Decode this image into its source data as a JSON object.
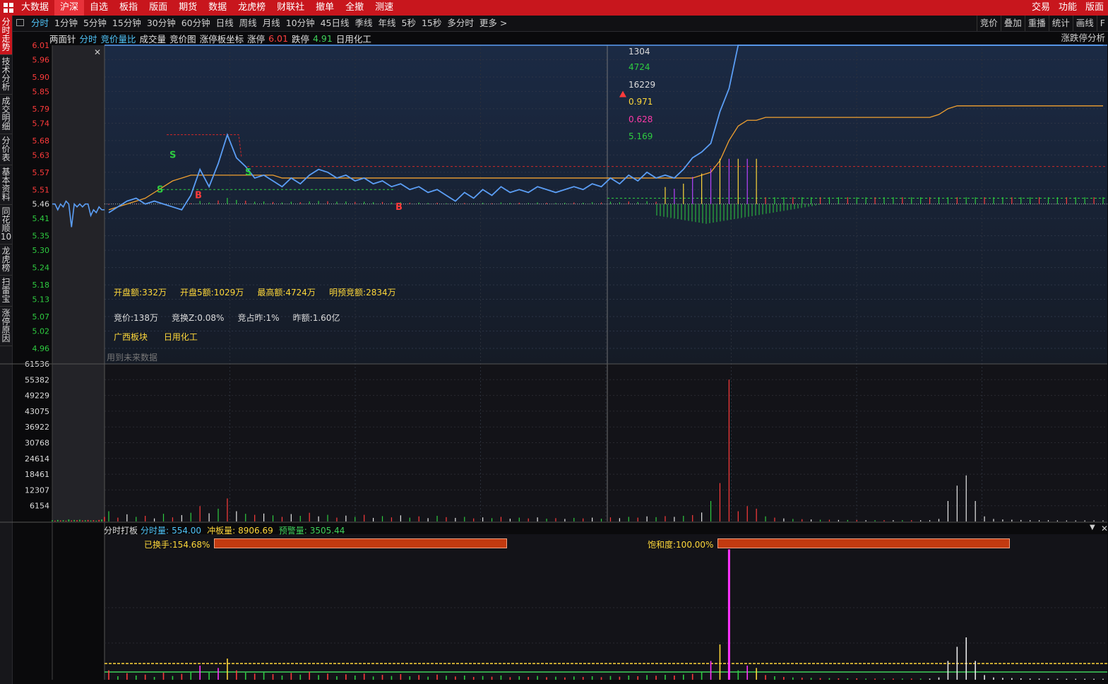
{
  "topbar": {
    "menu": [
      "大数据",
      "沪深",
      "自选",
      "板指",
      "版面",
      "期货",
      "数据",
      "龙虎榜",
      "财联社",
      "撤单",
      "全撤",
      "测速"
    ],
    "active_index": 1,
    "right": [
      "交易",
      "功能",
      "版面"
    ]
  },
  "leftnav": {
    "items": [
      "分时走势",
      "技术分析",
      "成交明细",
      "分价表",
      "基本资料",
      "同花顺10",
      "龙虎榜",
      "扫雷宝",
      "涨停原因"
    ],
    "active_index": 0
  },
  "periodbar": {
    "periods": [
      "分时",
      "1分钟",
      "5分钟",
      "15分钟",
      "30分钟",
      "60分钟",
      "日线",
      "周线",
      "月线",
      "10分钟",
      "45日线",
      "季线",
      "年线",
      "5秒",
      "15秒",
      "多分时",
      "更多 >"
    ],
    "active_index": 0,
    "tools": [
      "竞价",
      "叠加",
      "重播",
      "统计",
      "画线",
      "F"
    ]
  },
  "infobar": {
    "items": [
      {
        "text": "两面针",
        "color": "#e0e0e0"
      },
      {
        "text": "分时",
        "color": "#4fc3f7"
      },
      {
        "text": "竞价量比",
        "color": "#4fc3f7"
      },
      {
        "text": "成交量",
        "color": "#e0e0e0"
      },
      {
        "text": "竞价图",
        "color": "#e0e0e0"
      },
      {
        "text": "涨停板坐标",
        "color": "#e0e0e0"
      },
      {
        "text": "涨停",
        "color": "#e0e0e0"
      },
      {
        "text": "6.01",
        "color": "#ff4040"
      },
      {
        "text": "跌停",
        "color": "#e0e0e0"
      },
      {
        "text": "4.91",
        "color": "#3ed05a"
      },
      {
        "text": "日用化工",
        "color": "#e0e0e0"
      }
    ],
    "right": "涨跌停分析"
  },
  "colors": {
    "up": "#ff3b3b",
    "down": "#2ecc40",
    "price_line": "#5b9ef5",
    "avg_line": "#f0a030",
    "yellow": "#ffd83a",
    "magenta": "#ff33ff",
    "grid": "#3a3a3a",
    "panel_bg": "#18212f"
  },
  "price_axis": [
    "6.01",
    "5.96",
    "5.90",
    "5.85",
    "5.79",
    "5.74",
    "5.68",
    "5.63",
    "5.57",
    "5.51",
    "5.46",
    "5.41",
    "5.35",
    "5.30",
    "5.24",
    "5.18",
    "5.13",
    "5.07",
    "5.02",
    "4.96"
  ],
  "volume_axis": [
    "61536",
    "55382",
    "49229",
    "43075",
    "36922",
    "30768",
    "24614",
    "18461",
    "12307",
    "6154"
  ],
  "seal_labels": {
    "l1": "1304",
    "l2": "4724",
    "l3": "16229",
    "l4": "0.971",
    "l5": "0.628",
    "l6": "5.169"
  },
  "buy_sell_marks": [
    "S",
    "S",
    "S",
    "B",
    "B"
  ],
  "stats": {
    "row1": [
      {
        "label": "开盘额:",
        "value": "332万"
      },
      {
        "label": "开盘5额:",
        "value": "1029万"
      },
      {
        "label": "最高额:",
        "value": "4724万"
      },
      {
        "label": "明预竞额:",
        "value": "2834万"
      }
    ],
    "row2": [
      {
        "label": "竞价:",
        "value": "138万"
      },
      {
        "label": "竞换Z:",
        "value": "0.08%"
      },
      {
        "label": "竞占昨:",
        "value": "1%"
      },
      {
        "label": "昨额:",
        "value": "1.60亿"
      }
    ],
    "row3": [
      "广西板块",
      "日用化工"
    ],
    "future_note": "用到未来数据"
  },
  "bottom_panel": {
    "title": "分时打板",
    "fenshi_label": "分时量:",
    "fenshi_value": "554.00",
    "chongban_label": "冲板量:",
    "chongban_value": "8906.69",
    "yujing_label": "预警量:",
    "yujing_value": "3505.44",
    "turnover_label": "已换手:154.68%",
    "turnover_fraction": 1.0,
    "saturation_label": "饱和度:100.00%",
    "saturation_fraction": 1.0
  },
  "chart_data": {
    "type": "line",
    "price_range": [
      4.96,
      6.01
    ],
    "prev_close": 5.46,
    "limit_up": 6.01,
    "limit_down": 4.91,
    "auction_price": [
      5.46,
      5.46,
      5.44,
      5.46,
      5.45,
      5.47,
      5.46,
      5.38,
      5.46,
      5.45,
      5.46,
      5.45,
      5.46,
      5.46,
      5.42,
      5.44,
      5.43,
      5.45,
      5.44,
      5.44
    ],
    "price": [
      5.43,
      5.45,
      5.47,
      5.48,
      5.46,
      5.47,
      5.46,
      5.45,
      5.44,
      5.49,
      5.58,
      5.52,
      5.6,
      5.7,
      5.62,
      5.59,
      5.55,
      5.56,
      5.54,
      5.52,
      5.55,
      5.53,
      5.56,
      5.58,
      5.57,
      5.55,
      5.56,
      5.54,
      5.55,
      5.53,
      5.54,
      5.52,
      5.53,
      5.51,
      5.52,
      5.5,
      5.51,
      5.49,
      5.47,
      5.5,
      5.48,
      5.51,
      5.49,
      5.52,
      5.5,
      5.51,
      5.5,
      5.52,
      5.51,
      5.5,
      5.51,
      5.52,
      5.51,
      5.53,
      5.52,
      5.55,
      5.53,
      5.56,
      5.54,
      5.57,
      5.55,
      5.56,
      5.55,
      5.58,
      5.62,
      5.64,
      5.67,
      5.78,
      5.86,
      6.01,
      6.01,
      6.01,
      6.01,
      6.01,
      6.01,
      6.01,
      6.01,
      6.01,
      6.01,
      6.01,
      6.01,
      6.01,
      6.01,
      6.01,
      6.01,
      6.01,
      6.01,
      6.01,
      6.01,
      6.01,
      6.01,
      6.01,
      6.01,
      6.01,
      6.01,
      6.01,
      6.01,
      6.01,
      6.01,
      6.01,
      6.01,
      6.01,
      6.01,
      6.01,
      6.01,
      6.01,
      6.01,
      6.01,
      6.01,
      6.01
    ],
    "avg_price": [
      5.44,
      5.45,
      5.46,
      5.47,
      5.48,
      5.5,
      5.52,
      5.54,
      5.55,
      5.56,
      5.56,
      5.56,
      5.56,
      5.56,
      5.56,
      5.56,
      5.56,
      5.56,
      5.56,
      5.55,
      5.55,
      5.55,
      5.55,
      5.55,
      5.55,
      5.55,
      5.55,
      5.55,
      5.55,
      5.55,
      5.55,
      5.55,
      5.55,
      5.55,
      5.55,
      5.55,
      5.55,
      5.55,
      5.55,
      5.55,
      5.55,
      5.55,
      5.55,
      5.55,
      5.55,
      5.55,
      5.55,
      5.55,
      5.55,
      5.55,
      5.55,
      5.55,
      5.55,
      5.55,
      5.55,
      5.55,
      5.55,
      5.55,
      5.55,
      5.55,
      5.55,
      5.55,
      5.55,
      5.55,
      5.55,
      5.56,
      5.57,
      5.61,
      5.68,
      5.73,
      5.75,
      5.75,
      5.76,
      5.76,
      5.76,
      5.76,
      5.76,
      5.76,
      5.76,
      5.76,
      5.76,
      5.76,
      5.76,
      5.76,
      5.76,
      5.76,
      5.76,
      5.76,
      5.76,
      5.76,
      5.76,
      5.77,
      5.79,
      5.8,
      5.8,
      5.8,
      5.8,
      5.8,
      5.8,
      5.8,
      5.8,
      5.8,
      5.8,
      5.8,
      5.8,
      5.8,
      5.8,
      5.8,
      5.8,
      5.8
    ],
    "volume_range": [
      0,
      61536
    ],
    "volume": [
      4000,
      1500,
      2800,
      1800,
      2200,
      1200,
      3000,
      1600,
      2500,
      3400,
      6000,
      3200,
      5000,
      9000,
      4000,
      3000,
      2600,
      3100,
      2400,
      1800,
      2900,
      2200,
      3400,
      2000,
      2600,
      1500,
      2300,
      1800,
      2600,
      1400,
      2100,
      1600,
      2400,
      1500,
      2000,
      1300,
      2200,
      1700,
      1400,
      1800,
      1200,
      1600,
      1300,
      1800,
      1100,
      1500,
      1200,
      1600,
      1100,
      1300,
      1000,
      1400,
      1200,
      1500,
      1100,
      1600,
      1300,
      1800,
      1500,
      2000,
      1700,
      2100,
      1800,
      2200,
      2500,
      3500,
      8000,
      15000,
      55382,
      4000,
      6000,
      5000,
      2000,
      1500,
      1200,
      1000,
      900,
      800,
      700,
      700,
      600,
      600,
      600,
      500,
      500,
      500,
      500,
      500,
      500,
      500,
      500,
      1000,
      8000,
      14000,
      18000,
      8000,
      2000,
      1000,
      800,
      700,
      600,
      500,
      500,
      500,
      400,
      400,
      400,
      400,
      400,
      400
    ],
    "auction_volume": [
      500,
      300,
      600,
      400,
      500,
      300,
      800,
      400,
      600,
      500,
      700,
      400,
      500,
      600,
      400,
      500,
      300,
      600,
      800,
      1800
    ]
  }
}
